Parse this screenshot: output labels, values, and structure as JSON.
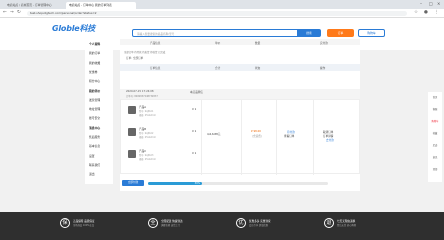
{
  "browser": {
    "tabs": [
      {
        "label": "电商站点 / 商城首页 - 订单管理中心"
      },
      {
        "label": "电商站点 - 订单中心 我的订单列表"
      }
    ],
    "url": "test.shopvilgtech.com/personal/order?status=2"
  },
  "header": {
    "logo": "Globle科技",
    "search_placeholder": "请输入您要搜索的商品名称/型号",
    "search_button": "搜索",
    "order_button": "订单",
    "cart_button": "购物车"
  },
  "sidebar": {
    "items": [
      {
        "label": "个人资料",
        "head": true
      },
      {
        "label": "我的订单"
      },
      {
        "label": "我的收藏"
      },
      {
        "label": "优惠券"
      },
      {
        "label": "积分中心"
      },
      {
        "label": "我的评价",
        "head": true
      },
      {
        "label": "发票管理"
      },
      {
        "label": "地址管理"
      },
      {
        "label": "账号安全"
      },
      {
        "label": "消息中心",
        "head": true
      },
      {
        "label": "售后服务"
      },
      {
        "label": "基本信息"
      },
      {
        "label": "设置"
      },
      {
        "label": "联系我们"
      },
      {
        "label": "退出"
      }
    ]
  },
  "main": {
    "table_head": [
      "产品信息",
      "单价",
      "数量",
      "实付款"
    ],
    "filter_text": "全部订单   待付款   待发货   待收货   已完成",
    "shop_row": "订单: 全部订单",
    "col_header": [
      "订单信息",
      "合计",
      "状态",
      "操作"
    ],
    "order_head": {
      "date": "2020-07-15 17:24:08",
      "order_no": "订单号: 8482837248732837",
      "shop": "本店品牌店"
    },
    "items": [
      {
        "name": "产品A",
        "spec": "型号: SAJ8-01",
        "spec2": "规格: 25x12mm",
        "qty": "X 1"
      },
      {
        "name": "产品B",
        "spec": "型号: SAJ8-02",
        "spec2": "规格: 25x12mm",
        "qty": "X 1"
      },
      {
        "name": "产品C",
        "spec": "型号: SAJ8-03",
        "spec2": "规格: 25x12mm",
        "qty": "X 1"
      }
    ],
    "total": "4,6,6.88元",
    "status_price": "¥ 98.00",
    "status_sub": "(含运费)",
    "status_label": "待付款",
    "status_sub2": "查看订单",
    "action_label": "取消订单",
    "action_sub": "订单详情",
    "action_btn": "去付款",
    "pay_button": "立即付款",
    "progress_value": 0.3,
    "progress_label": "30%"
  },
  "rail": {
    "items": [
      {
        "label": "首页"
      },
      {
        "label": "客服"
      },
      {
        "label": "购物车",
        "red": true
      },
      {
        "label": "收藏"
      },
      {
        "label": "足迹"
      },
      {
        "label": "意见"
      },
      {
        "label": "顶部"
      }
    ]
  },
  "footer": {
    "blocks": [
      {
        "icon": "保",
        "title": "正品保障 品质保证",
        "sub": "全场商品 100%正品"
      },
      {
        "icon": "全",
        "title": "全国配送 快速到达",
        "sub": "满额包邮 送货上门"
      },
      {
        "icon": "优",
        "title": "优惠多多 实惠到家",
        "sub": "会员专享 超值优惠"
      },
      {
        "icon": "退",
        "title": "七天无理由退换",
        "sub": "售后无忧 放心购物"
      }
    ]
  },
  "colors": {
    "accent": "#2a7bd6",
    "orange": "#ff7a1a",
    "footer_bg": "#2f2f2f"
  }
}
